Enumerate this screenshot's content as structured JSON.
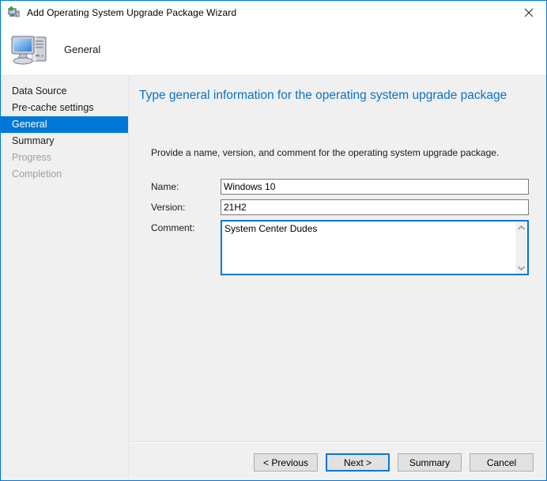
{
  "window": {
    "title": "Add Operating System Upgrade Package Wizard",
    "title_icon": "computer-add-icon",
    "close_icon": "close-icon",
    "border_color": "#0078d7"
  },
  "header": {
    "icon": "computer-icon",
    "title": "General"
  },
  "nav": {
    "items": [
      {
        "label": "Data Source",
        "state": "normal"
      },
      {
        "label": "Pre-cache settings",
        "state": "normal"
      },
      {
        "label": "General",
        "state": "selected"
      },
      {
        "label": "Summary",
        "state": "normal"
      },
      {
        "label": "Progress",
        "state": "disabled"
      },
      {
        "label": "Completion",
        "state": "disabled"
      }
    ],
    "selected_bg": "#0078d7",
    "selected_fg": "#ffffff",
    "disabled_fg": "#a0a0a0"
  },
  "content": {
    "heading": "Type general information for the operating system upgrade package",
    "heading_color": "#0b72c4",
    "instruction": "Provide a name, version, and comment for the operating system upgrade package.",
    "fields": {
      "name": {
        "label": "Name:",
        "value": "Windows 10",
        "placeholder": ""
      },
      "version": {
        "label": "Version:",
        "value": "21H2",
        "placeholder": ""
      },
      "comment": {
        "label": "Comment:",
        "value": "System Center Dudes",
        "placeholder": "",
        "focused": true,
        "scroll_up_icon": "chevron-up-icon",
        "scroll_down_icon": "chevron-down-icon"
      }
    }
  },
  "footer": {
    "buttons": [
      {
        "label": "< Previous",
        "default": false
      },
      {
        "label": "Next >",
        "default": true
      },
      {
        "label": "Summary",
        "default": false
      },
      {
        "label": "Cancel",
        "default": false
      }
    ]
  }
}
